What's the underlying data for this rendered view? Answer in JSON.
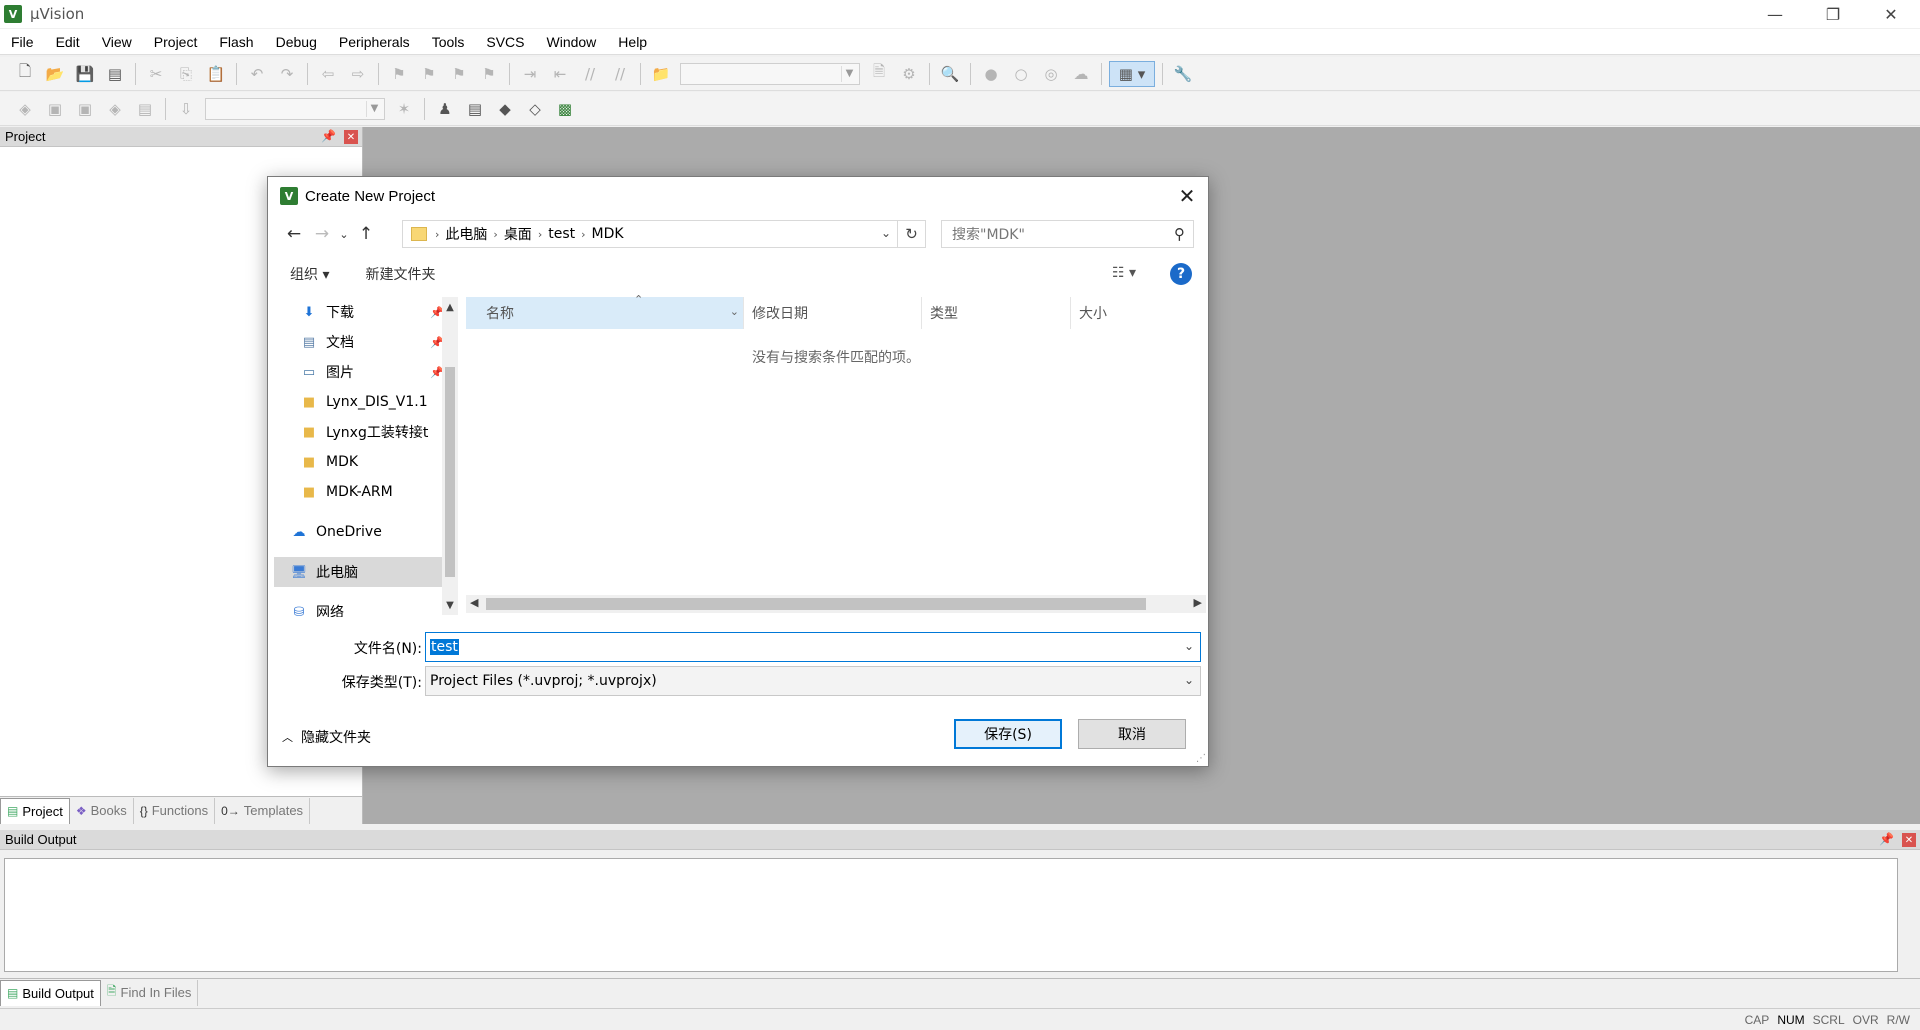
{
  "app": {
    "title": "µVision",
    "icon_letter": "V"
  },
  "window_controls": {
    "minimize": "—",
    "restore": "❐",
    "close": "✕"
  },
  "menu": [
    "File",
    "Edit",
    "View",
    "Project",
    "Flash",
    "Debug",
    "Peripherals",
    "Tools",
    "SVCS",
    "Window",
    "Help"
  ],
  "project_panel": {
    "title": "Project",
    "tabs": [
      {
        "label": "Project",
        "icon": "project-icon",
        "active": true
      },
      {
        "label": "Books",
        "icon": "books-icon",
        "active": false
      },
      {
        "label": "Functions",
        "icon": "functions-icon",
        "active": false
      },
      {
        "label": "Templates",
        "icon": "templates-icon",
        "active": false
      }
    ]
  },
  "build_panel": {
    "title": "Build Output",
    "tabs": [
      {
        "label": "Build Output",
        "active": true
      },
      {
        "label": "Find In Files",
        "active": false
      }
    ]
  },
  "statusbar": {
    "items": [
      "CAP",
      "NUM",
      "SCRL",
      "OVR",
      "R/W"
    ],
    "active": "NUM"
  },
  "dialog": {
    "title": "Create New Project",
    "breadcrumb": [
      "此电脑",
      "桌面",
      "test",
      "MDK"
    ],
    "search_placeholder": "搜索\"MDK\"",
    "organize_label": "组织 ▾",
    "new_folder_label": "新建文件夹",
    "nav_items": [
      {
        "label": "下载",
        "icon": "download-icon",
        "pinned": true
      },
      {
        "label": "文档",
        "icon": "document-icon",
        "pinned": true
      },
      {
        "label": "图片",
        "icon": "pictures-icon",
        "pinned": true
      },
      {
        "label": "Lynx_DIS_V1.1",
        "icon": "folder-icon",
        "pinned": false
      },
      {
        "label": "Lynxg工装转接t",
        "icon": "folder-icon",
        "pinned": false
      },
      {
        "label": "MDK",
        "icon": "folder-icon",
        "pinned": false
      },
      {
        "label": "MDK-ARM",
        "icon": "folder-icon",
        "pinned": false
      },
      {
        "label": "OneDrive",
        "icon": "cloud-icon",
        "pinned": false
      },
      {
        "label": "此电脑",
        "icon": "computer-icon",
        "pinned": false,
        "selected": true
      },
      {
        "label": "网络",
        "icon": "network-icon",
        "pinned": false
      }
    ],
    "columns": [
      "名称",
      "修改日期",
      "类型",
      "大小"
    ],
    "empty_message": "没有与搜索条件匹配的项。",
    "filename_label": "文件名(N):",
    "filename_value": "test",
    "filetype_label": "保存类型(T):",
    "filetype_value": "Project Files (*.uvproj; *.uvprojx)",
    "hide_folders_label": "隐藏文件夹",
    "save_label": "保存(S)",
    "cancel_label": "取消"
  }
}
